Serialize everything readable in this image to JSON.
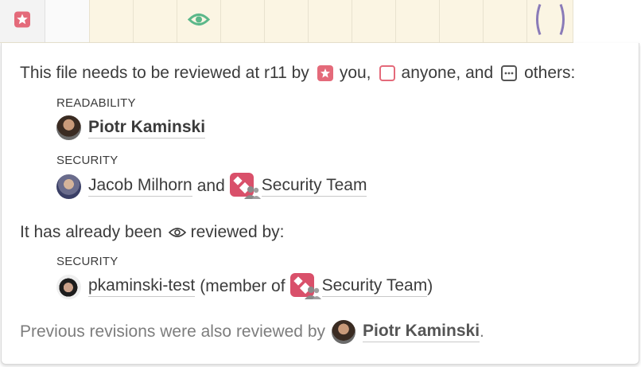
{
  "strip": {
    "icons": [
      "star-badge-icon",
      "eye-icon",
      "bracket-marker"
    ],
    "colors": {
      "star": "#e46a7a",
      "eye": "#5bb88a",
      "bracket": "#8a7bb8"
    }
  },
  "panel": {
    "needs_review": {
      "prefix": "This file needs to be reviewed at r11 by",
      "you": "you,",
      "anyone": "anyone, and",
      "others": "others:"
    },
    "readability": {
      "label": "READABILITY",
      "reviewer": "Piotr Kaminski"
    },
    "security_pending": {
      "label": "SECURITY",
      "reviewer": "Jacob Milhorn",
      "joiner": "and",
      "team": "Security Team"
    },
    "already_reviewed": {
      "prefix": "It has already been",
      "suffix": "reviewed by:"
    },
    "security_done": {
      "label": "SECURITY",
      "reviewer": "pkaminski-test",
      "member_prefix": "(member of",
      "team": "Security Team",
      "member_suffix": ")"
    },
    "previous": {
      "prefix": "Previous revisions were also reviewed by",
      "reviewer": "Piotr Kaminski",
      "suffix": "."
    }
  }
}
